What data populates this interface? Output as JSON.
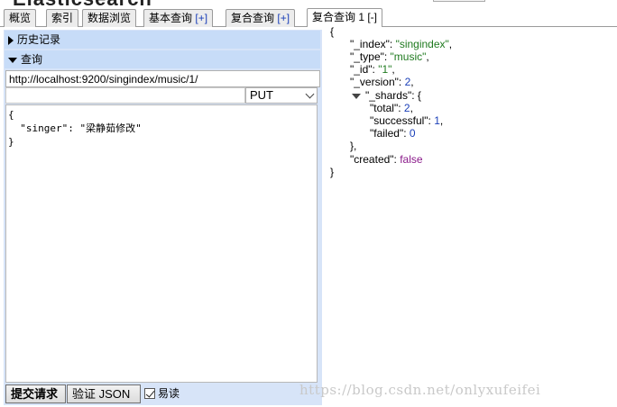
{
  "header": {
    "title": "Elasticsearch"
  },
  "tabs": [
    {
      "label": "概览"
    },
    {
      "label": "索引"
    },
    {
      "label": "数据浏览"
    },
    {
      "label": "基本查询",
      "plus": "[+]"
    },
    {
      "label": "复合查询",
      "plus": "[+]"
    },
    {
      "label": "复合查询 1 [-]",
      "active": true
    }
  ],
  "left": {
    "history_label": "历史记录",
    "query_label": "查询",
    "url": "http://localhost:9200/singindex/music/1/",
    "path": "",
    "method": "PUT",
    "body_lines": [
      "{",
      "  \"singer\": \"梁静茹修改\"",
      "}"
    ],
    "submit_label": "提交请求",
    "validate_label": "验证 JSON",
    "readable_label": "易读",
    "readable_checked": true
  },
  "response": {
    "open_brace": "{",
    "index_key": "\"_index\"",
    "index_val": "\"singindex\"",
    "type_key": "\"_type\"",
    "type_val": "\"music\"",
    "id_key": "\"_id\"",
    "id_val": "\"1\"",
    "version_key": "\"_version\"",
    "version_val": "2",
    "shards_key": "\"_shards\"",
    "total_key": "\"total\"",
    "total_val": "2",
    "successful_key": "\"successful\"",
    "successful_val": "1",
    "failed_key": "\"failed\"",
    "failed_val": "0",
    "close_inner": "},",
    "created_key": "\"created\"",
    "created_val": "false",
    "close_brace": "}"
  },
  "watermark": "https://blog.csdn.net/onlyxufeifei"
}
